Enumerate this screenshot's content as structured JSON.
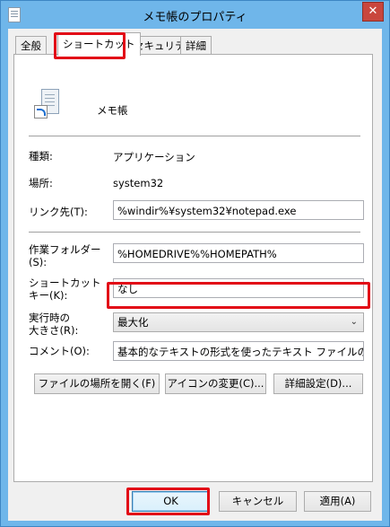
{
  "window": {
    "title": "メモ帳のプロパティ",
    "close_label": "✕"
  },
  "tabs": [
    {
      "label": "全般"
    },
    {
      "label": "ショートカット"
    },
    {
      "label": "セキュリティ"
    },
    {
      "label": "詳細"
    }
  ],
  "header": {
    "name": "メモ帳"
  },
  "info": {
    "type_label": "種類:",
    "type_value": "アプリケーション",
    "location_label": "場所:",
    "location_value": "system32"
  },
  "fields": {
    "target_label": "リンク先(T):",
    "target_value": "%windir%¥system32¥notepad.exe",
    "workdir_label_1": "作業フォルダー",
    "workdir_label_2": "(S):",
    "workdir_value": "%HOMEDRIVE%%HOMEPATH%",
    "shortcut_label_1": "ショートカット",
    "shortcut_label_2": "キー(K):",
    "shortcut_value": "なし",
    "run_label_1": "実行時の",
    "run_label_2": "大きさ(R):",
    "run_value": "最大化",
    "comment_label": "コメント(O):",
    "comment_value": "基本的なテキストの形式を使ったテキスト ファイルの表示と編集を行います。"
  },
  "buttons": {
    "open_location": "ファイルの場所を開く(F)",
    "change_icon": "アイコンの変更(C)...",
    "advanced": "詳細設定(D)...",
    "ok": "OK",
    "cancel": "キャンセル",
    "apply": "適用(A)"
  },
  "colors": {
    "highlight": "#e20b17",
    "frame": "#6fb6ea",
    "close": "#c9463d"
  }
}
